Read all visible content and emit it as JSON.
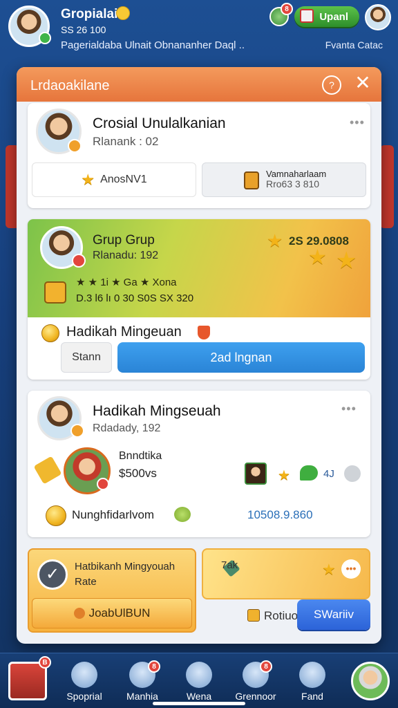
{
  "topbar": {
    "name": "Gropialai",
    "id": "SS 26 100",
    "subtitle": "Pagerialdaba Ulnait Obnananher Daql ..",
    "right_label": "Fvanta Catac",
    "pill_label": "Upanl",
    "notif_count": "8"
  },
  "modal": {
    "title": "Lrdaoakilane",
    "profile": {
      "name": "Crosial Unulalkanian",
      "sub": "Rlanank : 02",
      "btn_left": "AnosNV1",
      "btn_right_title": "Vamnaharlaam",
      "btn_right_sub": "Rro63 3 810"
    },
    "group": {
      "name": "Grup Grup",
      "sub": "Rlanadu: 192",
      "score": "2S 29.0808",
      "row1": "★ ★ 1i ★ Ga ★ Xona",
      "row2": "D.3 l6 lı 0 30 S0S SX 320",
      "label": "Hadikah Mingeuan",
      "btn_grey": "Stann",
      "btn_blue": "2ad lngnan"
    },
    "player": {
      "name": "Hadikah Mingseuah",
      "sub": "Rdadady, 192",
      "reward_title": "Bnndtika",
      "reward_value": "$500vs",
      "bottom_label": "Nunghfidarlvom",
      "bottom_value": "10508.9.860",
      "chat_count": "4J"
    },
    "bottom_left": {
      "title": "Hatbikanh Mingyouah",
      "sub": "Rate",
      "btn": "JoabUlBUN"
    },
    "bottom_right": {
      "label": "7ak",
      "left_text": "Rotiuo",
      "btn": "SWariiv"
    }
  },
  "nav": {
    "items": [
      {
        "label": "Spoprial",
        "badge": ""
      },
      {
        "label": "Manhia",
        "badge": "8"
      },
      {
        "label": "Wena",
        "badge": ""
      },
      {
        "label": "Grennoor",
        "badge": "8"
      },
      {
        "label": "Fand",
        "badge": ""
      }
    ],
    "left_badge": "B"
  },
  "colors": {
    "accent_orange": "#e6753c",
    "accent_blue": "#2e8ee0",
    "accent_green": "#2e8e2a",
    "background": "#1d4f93"
  }
}
